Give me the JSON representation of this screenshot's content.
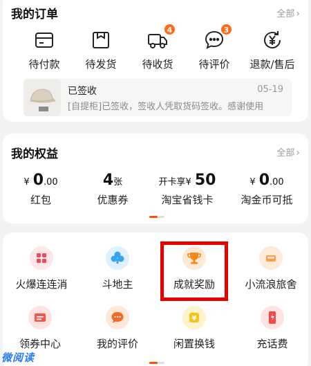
{
  "orders": {
    "title": "我的订单",
    "all_label": "全部",
    "items": [
      {
        "label": "待付款",
        "icon": "wallet-icon",
        "badge": null
      },
      {
        "label": "待发货",
        "icon": "package-box-icon",
        "badge": null
      },
      {
        "label": "待收货",
        "icon": "delivery-truck-icon",
        "badge": "4"
      },
      {
        "label": "待评价",
        "icon": "comment-bubble-icon",
        "badge": "3"
      },
      {
        "label": "退款/售后",
        "icon": "refund-yen-icon",
        "badge": null
      }
    ],
    "logistics": {
      "status": "已签收",
      "date": "05-19",
      "detail": "[自提柜]已签收，签收人凭取货码签收。感谢使用"
    }
  },
  "benefits": {
    "title": "我的权益",
    "all_label": "全部",
    "items": [
      {
        "prefix": "¥",
        "value": "0",
        "suffix": ".00",
        "label": "红包"
      },
      {
        "prefix": "",
        "value": "4",
        "suffix": "张",
        "label": "优惠券"
      },
      {
        "prefix": "开卡享¥",
        "value": "50",
        "suffix": "",
        "label": "淘宝省钱卡"
      },
      {
        "prefix": "¥",
        "value": "0",
        "suffix": ".00",
        "label": "淘金币可抵"
      }
    ]
  },
  "services": {
    "items": [
      {
        "label": "火爆连连消",
        "icon": "match-game-icon"
      },
      {
        "label": "斗地主",
        "icon": "card-game-icon"
      },
      {
        "label": "成就奖励",
        "icon": "trophy-icon"
      },
      {
        "label": "小流浪旅舍",
        "icon": "hostel-icon"
      },
      {
        "label": "领券中心",
        "icon": "coupon-icon"
      },
      {
        "label": "我的评价",
        "icon": "review-bubble-icon"
      },
      {
        "label": "闲置换钱",
        "icon": "idle-exchange-icon"
      },
      {
        "label": "充话费",
        "icon": "phone-recharge-icon"
      }
    ]
  },
  "watermark": "微阅读",
  "colors": {
    "accent": "#ff5000",
    "badge": "#ff6a1a",
    "highlight": "#e60000"
  }
}
